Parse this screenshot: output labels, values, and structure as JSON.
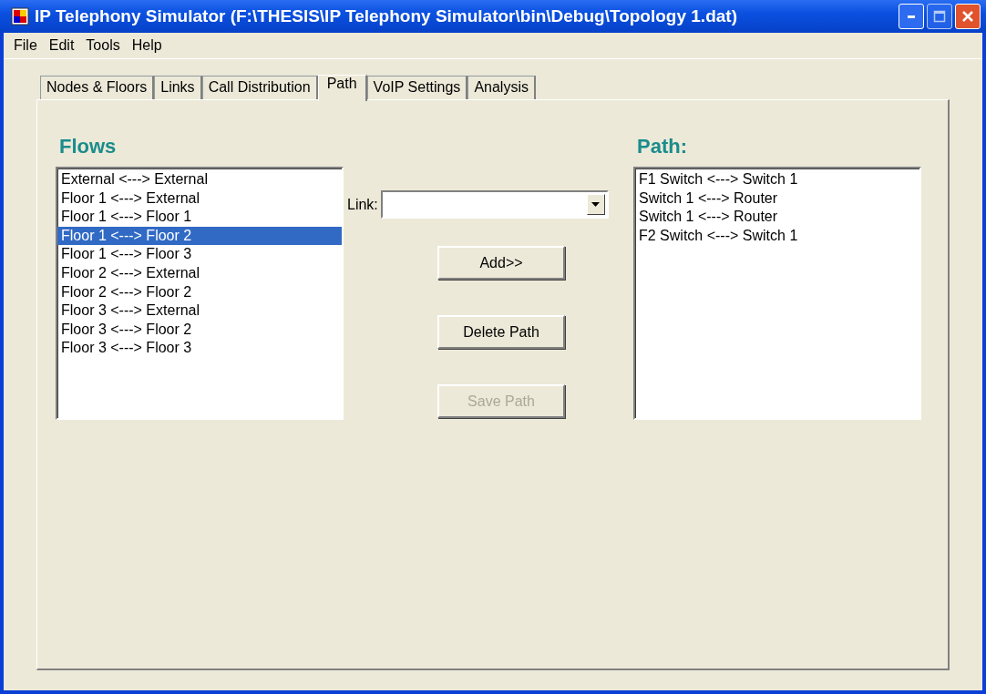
{
  "window": {
    "title": "IP Telephony Simulator (F:\\THESIS\\IP Telephony Simulator\\bin\\Debug\\Topology 1.dat)"
  },
  "menu": [
    "File",
    "Edit",
    "Tools",
    "Help"
  ],
  "tabs": [
    {
      "label": "Nodes & Floors",
      "selected": false
    },
    {
      "label": "Links",
      "selected": false
    },
    {
      "label": "Call Distribution",
      "selected": false
    },
    {
      "label": "Path",
      "selected": true
    },
    {
      "label": "VoIP Settings",
      "selected": false
    },
    {
      "label": "Analysis",
      "selected": false
    }
  ],
  "flows": {
    "heading": "Flows",
    "items": [
      {
        "label": "External <---> External",
        "selected": false
      },
      {
        "label": "Floor 1 <---> External",
        "selected": false
      },
      {
        "label": "Floor 1 <---> Floor 1",
        "selected": false
      },
      {
        "label": "Floor 1 <---> Floor 2",
        "selected": true
      },
      {
        "label": "Floor 1 <---> Floor 3",
        "selected": false
      },
      {
        "label": "Floor 2 <---> External",
        "selected": false
      },
      {
        "label": "Floor 2 <---> Floor 2",
        "selected": false
      },
      {
        "label": "Floor 3 <---> External",
        "selected": false
      },
      {
        "label": "Floor 3 <---> Floor 2",
        "selected": false
      },
      {
        "label": "Floor 3 <---> Floor 3",
        "selected": false
      }
    ]
  },
  "link": {
    "label": "Link:"
  },
  "buttons": [
    {
      "label": "Add>>",
      "disabled": false
    },
    {
      "label": "Delete Path",
      "disabled": false
    },
    {
      "label": "Save Path",
      "disabled": true
    }
  ],
  "path": {
    "heading": "Path:",
    "items": [
      "F1 Switch <---> Switch 1",
      "Switch 1 <---> Router",
      "Switch 1 <---> Router",
      "F2 Switch <---> Switch 1"
    ]
  }
}
